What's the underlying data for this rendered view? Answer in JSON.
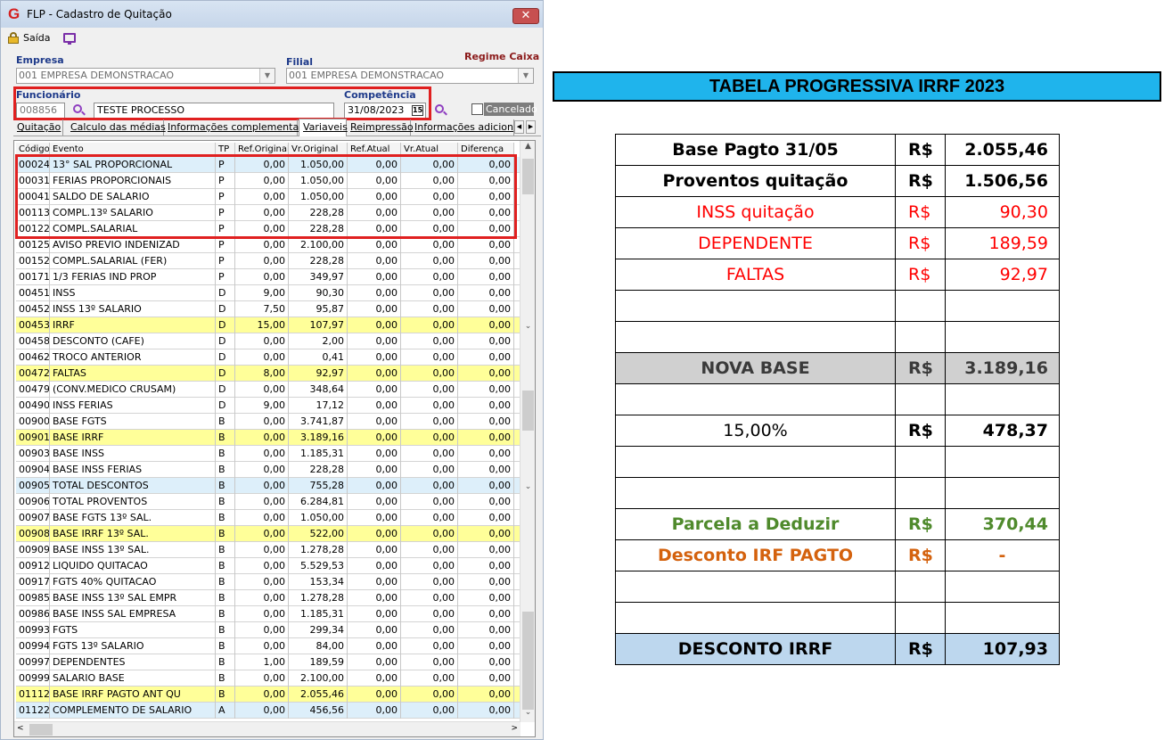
{
  "window": {
    "title": "FLP - Cadastro de Quitação",
    "close": "✕"
  },
  "toolbar": {
    "saida": "Saída"
  },
  "form": {
    "empresa_label": "Empresa",
    "empresa_value": "001 EMPRESA DEMONSTRACAO",
    "filial_label": "Filial",
    "filial_value": "001 EMPRESA DEMONSTRACAO",
    "regime": "Regime Caixa",
    "funcionario_label": "Funcionário",
    "funcionario_code": "008856",
    "funcionario_name": "TESTE PROCESSO",
    "competencia_label": "Competência",
    "competencia_value": "31/08/2023",
    "calendar": "15",
    "cancelado": "Cancelado"
  },
  "tabs": [
    "Quitação",
    "Calculo das médias",
    "Informações complementares",
    "Variaveis",
    "Reimpressão",
    "Informações adicionais"
  ],
  "grid": {
    "headers": [
      "Código",
      "Evento",
      "TP",
      "Ref.Original",
      "Vr.Original",
      "Ref.Atual",
      "Vr.Atual",
      "Diferença"
    ],
    "rows": [
      {
        "cod": "00024",
        "evento": "13° SAL PROPORCIONAL",
        "tp": "P",
        "ref_orig": "0,00",
        "vr_orig": "1.050,00",
        "ref_atual": "0,00",
        "vr_atual": "0,00",
        "dif": "0,00",
        "hl": "blue"
      },
      {
        "cod": "00031",
        "evento": "FERIAS PROPORCIONAIS",
        "tp": "P",
        "ref_orig": "0,00",
        "vr_orig": "1.050,00",
        "ref_atual": "0,00",
        "vr_atual": "0,00",
        "dif": "0,00",
        "hl": ""
      },
      {
        "cod": "00041",
        "evento": "SALDO DE SALARIO",
        "tp": "P",
        "ref_orig": "0,00",
        "vr_orig": "1.050,00",
        "ref_atual": "0,00",
        "vr_atual": "0,00",
        "dif": "0,00",
        "hl": ""
      },
      {
        "cod": "00113",
        "evento": "COMPL.13º SALARIO",
        "tp": "P",
        "ref_orig": "0,00",
        "vr_orig": "228,28",
        "ref_atual": "0,00",
        "vr_atual": "0,00",
        "dif": "0,00",
        "hl": ""
      },
      {
        "cod": "00122",
        "evento": "COMPL.SALARIAL",
        "tp": "P",
        "ref_orig": "0,00",
        "vr_orig": "228,28",
        "ref_atual": "0,00",
        "vr_atual": "0,00",
        "dif": "0,00",
        "hl": ""
      },
      {
        "cod": "00125",
        "evento": "AVISO PREVIO INDENIZAD",
        "tp": "P",
        "ref_orig": "0,00",
        "vr_orig": "2.100,00",
        "ref_atual": "0,00",
        "vr_atual": "0,00",
        "dif": "0,00",
        "hl": ""
      },
      {
        "cod": "00152",
        "evento": "COMPL.SALARIAL (FER)",
        "tp": "P",
        "ref_orig": "0,00",
        "vr_orig": "228,28",
        "ref_atual": "0,00",
        "vr_atual": "0,00",
        "dif": "0,00",
        "hl": ""
      },
      {
        "cod": "00171",
        "evento": "1/3 FERIAS IND PROP",
        "tp": "P",
        "ref_orig": "0,00",
        "vr_orig": "349,97",
        "ref_atual": "0,00",
        "vr_atual": "0,00",
        "dif": "0,00",
        "hl": ""
      },
      {
        "cod": "00451",
        "evento": "INSS",
        "tp": "D",
        "ref_orig": "9,00",
        "vr_orig": "90,30",
        "ref_atual": "0,00",
        "vr_atual": "0,00",
        "dif": "0,00",
        "hl": ""
      },
      {
        "cod": "00452",
        "evento": "INSS 13º SALARIO",
        "tp": "D",
        "ref_orig": "7,50",
        "vr_orig": "95,87",
        "ref_atual": "0,00",
        "vr_atual": "0,00",
        "dif": "0,00",
        "hl": ""
      },
      {
        "cod": "00453",
        "evento": "IRRF",
        "tp": "D",
        "ref_orig": "15,00",
        "vr_orig": "107,97",
        "ref_atual": "0,00",
        "vr_atual": "0,00",
        "dif": "0,00",
        "hl": "yellow"
      },
      {
        "cod": "00458",
        "evento": "DESCONTO (CAFE)",
        "tp": "D",
        "ref_orig": "0,00",
        "vr_orig": "2,00",
        "ref_atual": "0,00",
        "vr_atual": "0,00",
        "dif": "0,00",
        "hl": ""
      },
      {
        "cod": "00462",
        "evento": "TROCO ANTERIOR",
        "tp": "D",
        "ref_orig": "0,00",
        "vr_orig": "0,41",
        "ref_atual": "0,00",
        "vr_atual": "0,00",
        "dif": "0,00",
        "hl": ""
      },
      {
        "cod": "00472",
        "evento": "FALTAS",
        "tp": "D",
        "ref_orig": "8,00",
        "vr_orig": "92,97",
        "ref_atual": "0,00",
        "vr_atual": "0,00",
        "dif": "0,00",
        "hl": "yellow"
      },
      {
        "cod": "00479",
        "evento": "(CONV.MEDICO CRUSAM)",
        "tp": "D",
        "ref_orig": "0,00",
        "vr_orig": "348,64",
        "ref_atual": "0,00",
        "vr_atual": "0,00",
        "dif": "0,00",
        "hl": ""
      },
      {
        "cod": "00490",
        "evento": "INSS FERIAS",
        "tp": "D",
        "ref_orig": "9,00",
        "vr_orig": "17,12",
        "ref_atual": "0,00",
        "vr_atual": "0,00",
        "dif": "0,00",
        "hl": ""
      },
      {
        "cod": "00900",
        "evento": "BASE FGTS",
        "tp": "B",
        "ref_orig": "0,00",
        "vr_orig": "3.741,87",
        "ref_atual": "0,00",
        "vr_atual": "0,00",
        "dif": "0,00",
        "hl": ""
      },
      {
        "cod": "00901",
        "evento": "BASE IRRF",
        "tp": "B",
        "ref_orig": "0,00",
        "vr_orig": "3.189,16",
        "ref_atual": "0,00",
        "vr_atual": "0,00",
        "dif": "0,00",
        "hl": "yellow"
      },
      {
        "cod": "00903",
        "evento": "BASE INSS",
        "tp": "B",
        "ref_orig": "0,00",
        "vr_orig": "1.185,31",
        "ref_atual": "0,00",
        "vr_atual": "0,00",
        "dif": "0,00",
        "hl": ""
      },
      {
        "cod": "00904",
        "evento": "BASE INSS FERIAS",
        "tp": "B",
        "ref_orig": "0,00",
        "vr_orig": "228,28",
        "ref_atual": "0,00",
        "vr_atual": "0,00",
        "dif": "0,00",
        "hl": ""
      },
      {
        "cod": "00905",
        "evento": "TOTAL DESCONTOS",
        "tp": "B",
        "ref_orig": "0,00",
        "vr_orig": "755,28",
        "ref_atual": "0,00",
        "vr_atual": "0,00",
        "dif": "0,00",
        "hl": "blue"
      },
      {
        "cod": "00906",
        "evento": "TOTAL PROVENTOS",
        "tp": "B",
        "ref_orig": "0,00",
        "vr_orig": "6.284,81",
        "ref_atual": "0,00",
        "vr_atual": "0,00",
        "dif": "0,00",
        "hl": ""
      },
      {
        "cod": "00907",
        "evento": "BASE FGTS 13º SAL.",
        "tp": "B",
        "ref_orig": "0,00",
        "vr_orig": "1.050,00",
        "ref_atual": "0,00",
        "vr_atual": "0,00",
        "dif": "0,00",
        "hl": ""
      },
      {
        "cod": "00908",
        "evento": "BASE IRRF 13º SAL.",
        "tp": "B",
        "ref_orig": "0,00",
        "vr_orig": "522,00",
        "ref_atual": "0,00",
        "vr_atual": "0,00",
        "dif": "0,00",
        "hl": "yellow"
      },
      {
        "cod": "00909",
        "evento": "BASE INSS 13º SAL.",
        "tp": "B",
        "ref_orig": "0,00",
        "vr_orig": "1.278,28",
        "ref_atual": "0,00",
        "vr_atual": "0,00",
        "dif": "0,00",
        "hl": ""
      },
      {
        "cod": "00912",
        "evento": "LIQUIDO QUITACAO",
        "tp": "B",
        "ref_orig": "0,00",
        "vr_orig": "5.529,53",
        "ref_atual": "0,00",
        "vr_atual": "0,00",
        "dif": "0,00",
        "hl": ""
      },
      {
        "cod": "00917",
        "evento": "FGTS 40% QUITACAO",
        "tp": "B",
        "ref_orig": "0,00",
        "vr_orig": "153,34",
        "ref_atual": "0,00",
        "vr_atual": "0,00",
        "dif": "0,00",
        "hl": ""
      },
      {
        "cod": "00985",
        "evento": "BASE INSS 13º SAL EMPR",
        "tp": "B",
        "ref_orig": "0,00",
        "vr_orig": "1.278,28",
        "ref_atual": "0,00",
        "vr_atual": "0,00",
        "dif": "0,00",
        "hl": ""
      },
      {
        "cod": "00986",
        "evento": "BASE INSS SAL EMPRESA",
        "tp": "B",
        "ref_orig": "0,00",
        "vr_orig": "1.185,31",
        "ref_atual": "0,00",
        "vr_atual": "0,00",
        "dif": "0,00",
        "hl": ""
      },
      {
        "cod": "00993",
        "evento": "FGTS",
        "tp": "B",
        "ref_orig": "0,00",
        "vr_orig": "299,34",
        "ref_atual": "0,00",
        "vr_atual": "0,00",
        "dif": "0,00",
        "hl": ""
      },
      {
        "cod": "00994",
        "evento": "FGTS 13º SALARIO",
        "tp": "B",
        "ref_orig": "0,00",
        "vr_orig": "84,00",
        "ref_atual": "0,00",
        "vr_atual": "0,00",
        "dif": "0,00",
        "hl": ""
      },
      {
        "cod": "00997",
        "evento": "DEPENDENTES",
        "tp": "B",
        "ref_orig": "1,00",
        "vr_orig": "189,59",
        "ref_atual": "0,00",
        "vr_atual": "0,00",
        "dif": "0,00",
        "hl": ""
      },
      {
        "cod": "00999",
        "evento": "SALARIO BASE",
        "tp": "B",
        "ref_orig": "0,00",
        "vr_orig": "2.100,00",
        "ref_atual": "0,00",
        "vr_atual": "0,00",
        "dif": "0,00",
        "hl": ""
      },
      {
        "cod": "01112",
        "evento": "BASE IRRF PAGTO ANT QU",
        "tp": "B",
        "ref_orig": "0,00",
        "vr_orig": "2.055,46",
        "ref_atual": "0,00",
        "vr_atual": "0,00",
        "dif": "0,00",
        "hl": "yellow"
      },
      {
        "cod": "01122",
        "evento": "COMPLEMENTO DE SALARIO",
        "tp": "A",
        "ref_orig": "0,00",
        "vr_orig": "456,56",
        "ref_atual": "0,00",
        "vr_atual": "0,00",
        "dif": "0,00",
        "hl": "blue"
      }
    ],
    "highlight_colors": {
      "yellow": "#ffff99",
      "blue": "#ddeffa"
    }
  },
  "sheet": {
    "title": "TABELA PROGRESSIVA IRRF 2023",
    "rows": [
      {
        "label": "Base Pagto 31/05",
        "cur": "R$",
        "val": "2.055,46",
        "style": "xb"
      },
      {
        "label": "Proventos quitação",
        "cur": "R$",
        "val": "1.506,56",
        "style": "xb"
      },
      {
        "label": "INSS quitação",
        "cur": "R$",
        "val": "90,30",
        "style": "xr"
      },
      {
        "label": "DEPENDENTE",
        "cur": "R$",
        "val": "189,59",
        "style": "xr"
      },
      {
        "label": "FALTAS",
        "cur": "R$",
        "val": "92,97",
        "style": "xr"
      },
      {
        "label": "",
        "cur": "",
        "val": "",
        "style": ""
      },
      {
        "label": "",
        "cur": "",
        "val": "",
        "style": ""
      },
      {
        "label": "NOVA BASE",
        "cur": "R$",
        "val": "3.189,16",
        "style": "xgray"
      },
      {
        "label": "",
        "cur": "",
        "val": "",
        "style": ""
      },
      {
        "label": "15,00%",
        "cur": "R$",
        "val": "478,37",
        "style": "pct"
      },
      {
        "label": "",
        "cur": "",
        "val": "",
        "style": ""
      },
      {
        "label": "",
        "cur": "",
        "val": "",
        "style": ""
      },
      {
        "label": "Parcela a Deduzir",
        "cur": "R$",
        "val": "370,44",
        "style": "xgreen"
      },
      {
        "label": "Desconto IRF PAGTO",
        "cur": "R$",
        "val": "-",
        "style": "xorange"
      },
      {
        "label": "",
        "cur": "",
        "val": "",
        "style": ""
      },
      {
        "label": "",
        "cur": "",
        "val": "",
        "style": ""
      },
      {
        "label": "DESCONTO IRRF",
        "cur": "R$",
        "val": "107,93",
        "style": "xblue"
      }
    ]
  }
}
